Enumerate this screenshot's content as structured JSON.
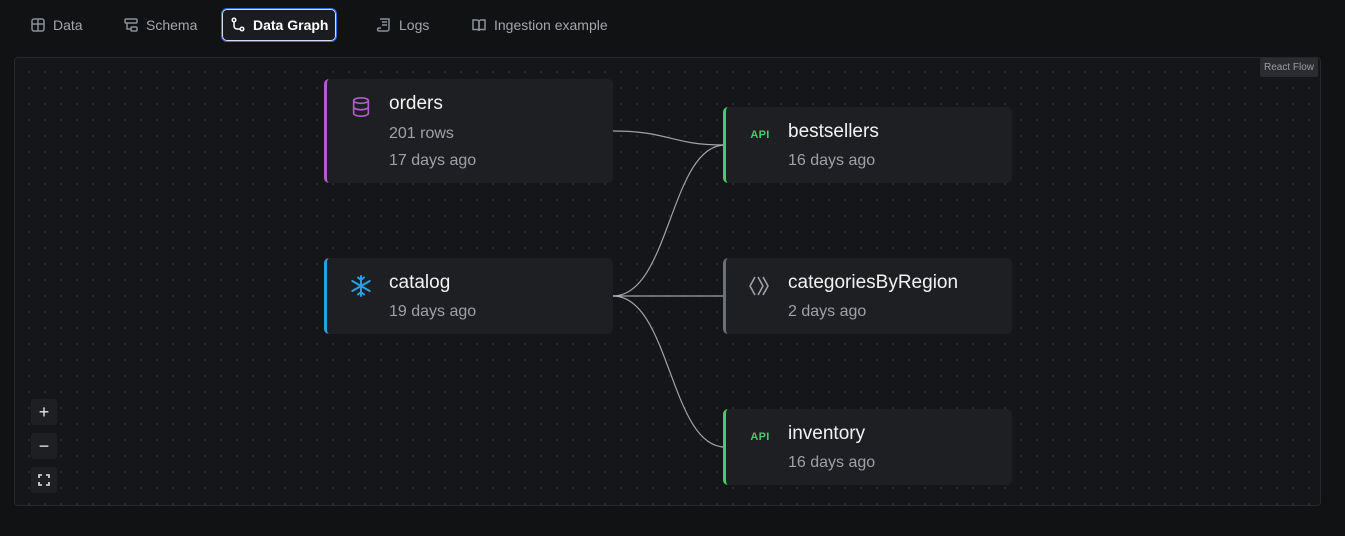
{
  "tabs": [
    {
      "label": "Data",
      "icon": "table-icon"
    },
    {
      "label": "Schema",
      "icon": "schema-icon"
    },
    {
      "label": "Data Graph",
      "icon": "graph-icon",
      "active": true
    },
    {
      "label": "Logs",
      "icon": "logs-icon"
    },
    {
      "label": "Ingestion example",
      "icon": "book-icon"
    }
  ],
  "flow": {
    "attribution": "React Flow",
    "nodes": {
      "orders": {
        "title": "orders",
        "rows": "201 rows",
        "updated": "17 days ago",
        "icon": "database-icon",
        "accent": "#b35bd0"
      },
      "catalog": {
        "title": "catalog",
        "updated": "19 days ago",
        "icon": "snowflake-icon",
        "accent": "#2aa0e0"
      },
      "bestsellers": {
        "title": "bestsellers",
        "updated": "16 days ago",
        "badge": "API",
        "accent": "#3ecf6e"
      },
      "categoriesByRegion": {
        "title": "categoriesByRegion",
        "updated": "2 days ago",
        "icon": "pipe-icon",
        "accent": "#6d7077"
      },
      "inventory": {
        "title": "inventory",
        "updated": "16 days ago",
        "badge": "API",
        "accent": "#3ecf6e"
      }
    },
    "edges": [
      [
        "orders",
        "bestsellers"
      ],
      [
        "catalog",
        "bestsellers"
      ],
      [
        "catalog",
        "categoriesByRegion"
      ],
      [
        "catalog",
        "inventory"
      ]
    ],
    "controls": {
      "zoom_in": "+",
      "zoom_out": "−"
    }
  }
}
